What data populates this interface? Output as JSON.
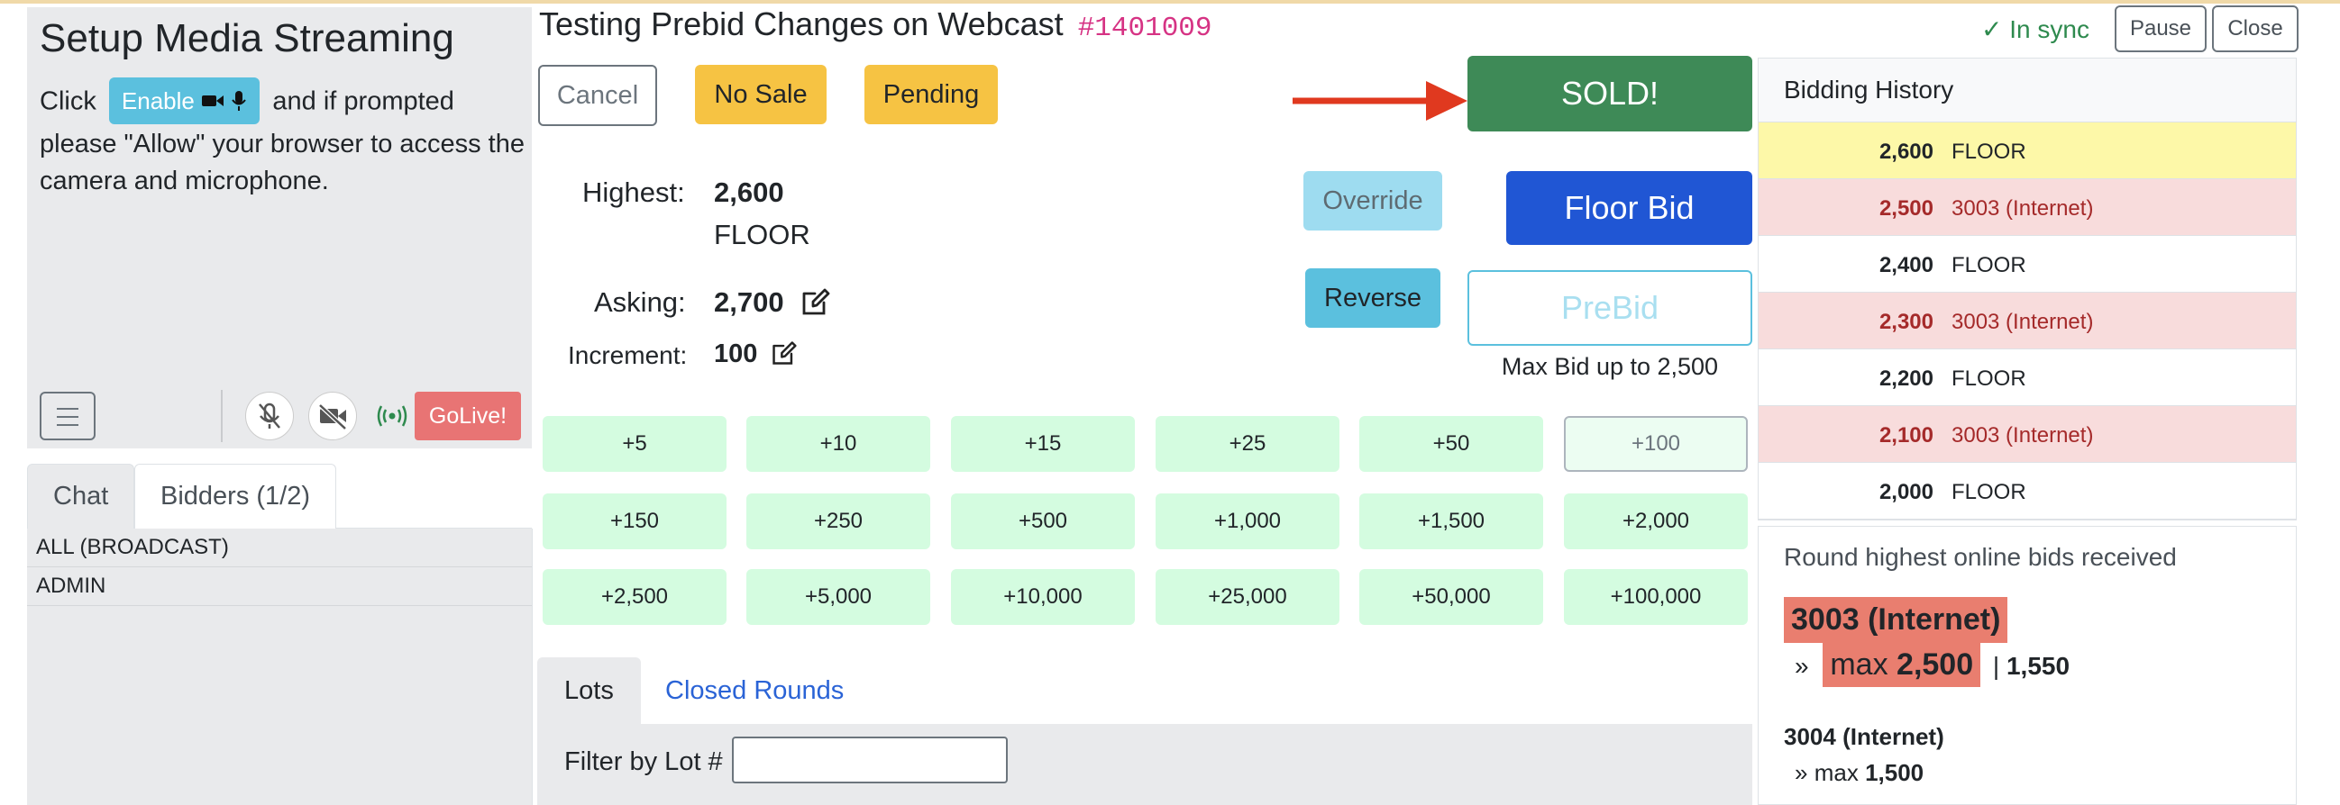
{
  "media": {
    "title": "Setup Media Streaming",
    "click_text": "Click",
    "enable_label": "Enable",
    "after_enable": "and if prompted please \"Allow\" your browser to access the camera and microphone.",
    "golive_label": "GoLive!",
    "icons": [
      "menu-icon",
      "mic-muted-icon",
      "camera-off-icon",
      "broadcast-icon"
    ]
  },
  "chat": {
    "tabs": [
      "Chat",
      "Bidders (1/2)"
    ],
    "rows": [
      "ALL (BROADCAST)",
      "ADMIN"
    ]
  },
  "lot": {
    "title": "Testing Prebid Changes on Webcast",
    "number": "#1401009"
  },
  "actions": {
    "cancel": "Cancel",
    "no_sale": "No Sale",
    "pending": "Pending",
    "sold": "SOLD!",
    "override": "Override",
    "reverse": "Reverse",
    "floor_bid": "Floor Bid",
    "prebid": "PreBid",
    "max_bid_note": "Max Bid up to 2,500"
  },
  "bid": {
    "highest_label": "Highest:",
    "highest_value": "2,600",
    "highest_by": "FLOOR",
    "asking_label": "Asking:",
    "asking_value": "2,700",
    "increment_label": "Increment:",
    "increment_value": "100"
  },
  "increments": [
    [
      "+5",
      "+10",
      "+15",
      "+25",
      "+50",
      "+100"
    ],
    [
      "+150",
      "+250",
      "+500",
      "+1,000",
      "+1,500",
      "+2,000"
    ],
    [
      "+2,500",
      "+5,000",
      "+10,000",
      "+25,000",
      "+50,000",
      "+100,000"
    ]
  ],
  "lots_tabs": [
    "Lots",
    "Closed Rounds"
  ],
  "filter_label": "Filter by Lot #",
  "status": {
    "sync": "✓ In sync",
    "pause": "Pause",
    "close": "Close"
  },
  "history": {
    "title": "Bidding History",
    "rows": [
      {
        "amount": "2,600",
        "bidder": "FLOOR",
        "kind": "highlight"
      },
      {
        "amount": "2,500",
        "bidder": "3003 (Internet)",
        "kind": "internet"
      },
      {
        "amount": "2,400",
        "bidder": "FLOOR",
        "kind": "floor"
      },
      {
        "amount": "2,300",
        "bidder": "3003 (Internet)",
        "kind": "internet"
      },
      {
        "amount": "2,200",
        "bidder": "FLOOR",
        "kind": "floor"
      },
      {
        "amount": "2,100",
        "bidder": "3003 (Internet)",
        "kind": "internet"
      },
      {
        "amount": "2,000",
        "bidder": "FLOOR",
        "kind": "floor"
      }
    ],
    "colors": {
      "highlight": "#fdf8a8",
      "internet": "#f8dcdc",
      "floor": "#ffffff",
      "internet_text": "#a52a2a"
    }
  },
  "online": {
    "title": "Round highest online bids received",
    "top_bidder": "3003 (Internet)",
    "top_prefix": "»",
    "top_max_label": "max",
    "top_max_value": "2,500",
    "top_sep": "|",
    "top_current": "1,550",
    "second_bidder": "3004 (Internet)",
    "second_prefix": "»",
    "second_max_label": "max",
    "second_max_value": "1,500"
  }
}
